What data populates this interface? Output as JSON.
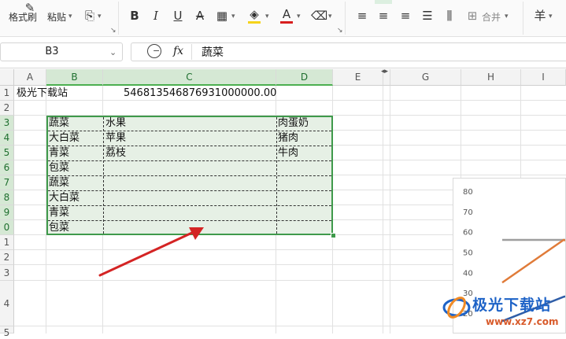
{
  "ribbon": {
    "format_painter": "格式刷",
    "paste": "粘贴",
    "merge": "合并",
    "bold": "B",
    "italic": "I",
    "underline": "U",
    "strike": "A",
    "font_color_glyph": "A",
    "currency": "羊",
    "highlight_color": "#f5d31a",
    "font_color": "#d81e1e"
  },
  "formula_bar": {
    "name_box": "B3",
    "fx": "fx",
    "content": "蔬菜"
  },
  "columns": [
    "A",
    "B",
    "C",
    "D",
    "E",
    "G",
    "H",
    "I"
  ],
  "rows": [
    "1",
    "2",
    "3",
    "4",
    "5",
    "6",
    "7",
    "8",
    "9",
    "0",
    "1",
    "2",
    "3",
    "4",
    "5"
  ],
  "cells": {
    "A1": "极光下载站",
    "C1": "546813546876931000000.00",
    "B3": "蔬菜",
    "C3": "水果",
    "D3": "肉蛋奶",
    "B4": "大白菜",
    "C4": "苹果",
    "D4": "猪肉",
    "B5": "青菜",
    "C5": "荔枝",
    "D5": "牛肉",
    "B6": "包菜",
    "B7": "蔬菜",
    "B8": "大白菜",
    "B9": "青菜",
    "B10": "包菜"
  },
  "chart_data": {
    "type": "line",
    "yticks": [
      "80",
      "70",
      "60",
      "50",
      "40",
      "30",
      "20"
    ],
    "ylim": [
      20,
      80
    ],
    "series": [
      {
        "color": "#9e9e9e",
        "x": [
          0,
          1,
          2
        ],
        "values": [
          56,
          56,
          59
        ]
      },
      {
        "color": "#e07b39",
        "x": [
          0,
          1,
          2
        ],
        "values": [
          35,
          56,
          45
        ]
      },
      {
        "color": "#2f5ea8",
        "x": [
          0,
          1,
          2
        ],
        "values": [
          16,
          28,
          34
        ]
      }
    ],
    "grid": false
  },
  "watermark": {
    "text": "极光下载站",
    "url": "www.xz7.com"
  }
}
